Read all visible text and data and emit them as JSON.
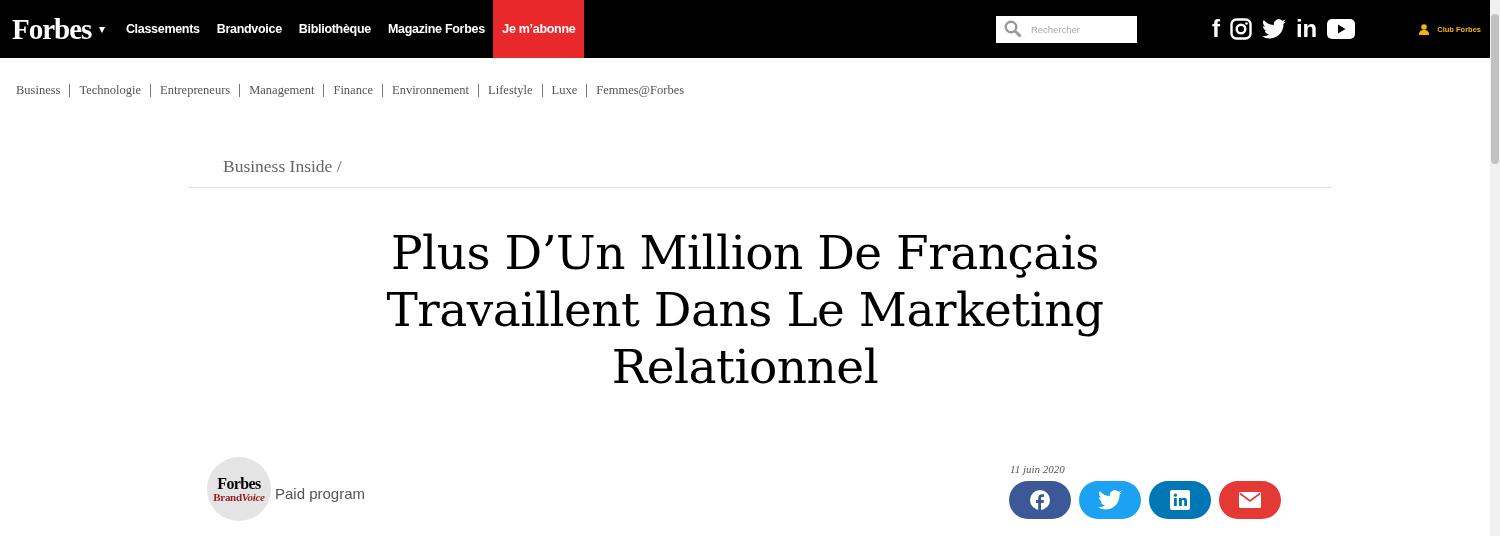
{
  "header": {
    "logo": "Forbes",
    "menu_caret": "▾",
    "nav": [
      {
        "label": "Classements",
        "kind": "link"
      },
      {
        "label": "Brandvoice",
        "kind": "link"
      },
      {
        "label": "Bibliothèque",
        "kind": "link"
      },
      {
        "label": "Magazine Forbes",
        "kind": "link"
      },
      {
        "label": "Je m’abonne",
        "kind": "cta"
      }
    ],
    "search": {
      "placeholder": "Rechercher"
    },
    "social": [
      {
        "kind": "facebook",
        "text": "f"
      },
      {
        "kind": "instagram"
      },
      {
        "kind": "twitter"
      },
      {
        "kind": "linkedin",
        "text": "in"
      },
      {
        "kind": "youtube"
      }
    ],
    "account": "Club Forbes"
  },
  "categories": [
    "Business",
    "Technologie",
    "Entrepreneurs",
    "Management",
    "Finance",
    "Environnement",
    "Lifestyle",
    "Luxe",
    "Femmes@Forbes"
  ],
  "breadcrumb": "Business Inside /",
  "title": [
    "Plus D’Un Million De Français",
    "Travaillent Dans Le Marketing",
    "Relationnel"
  ],
  "byline": {
    "logo_top": "Forbes",
    "logo_brand": "Brand",
    "logo_voice": "Voice",
    "label": "Paid program"
  },
  "date": "11 juin 2020",
  "share": [
    {
      "kind": "facebook",
      "color": "#3b5998"
    },
    {
      "kind": "twitter",
      "color": "#1da1f2"
    },
    {
      "kind": "linkedin",
      "color": "#0077b5"
    },
    {
      "kind": "email",
      "color": "#e53935"
    }
  ]
}
